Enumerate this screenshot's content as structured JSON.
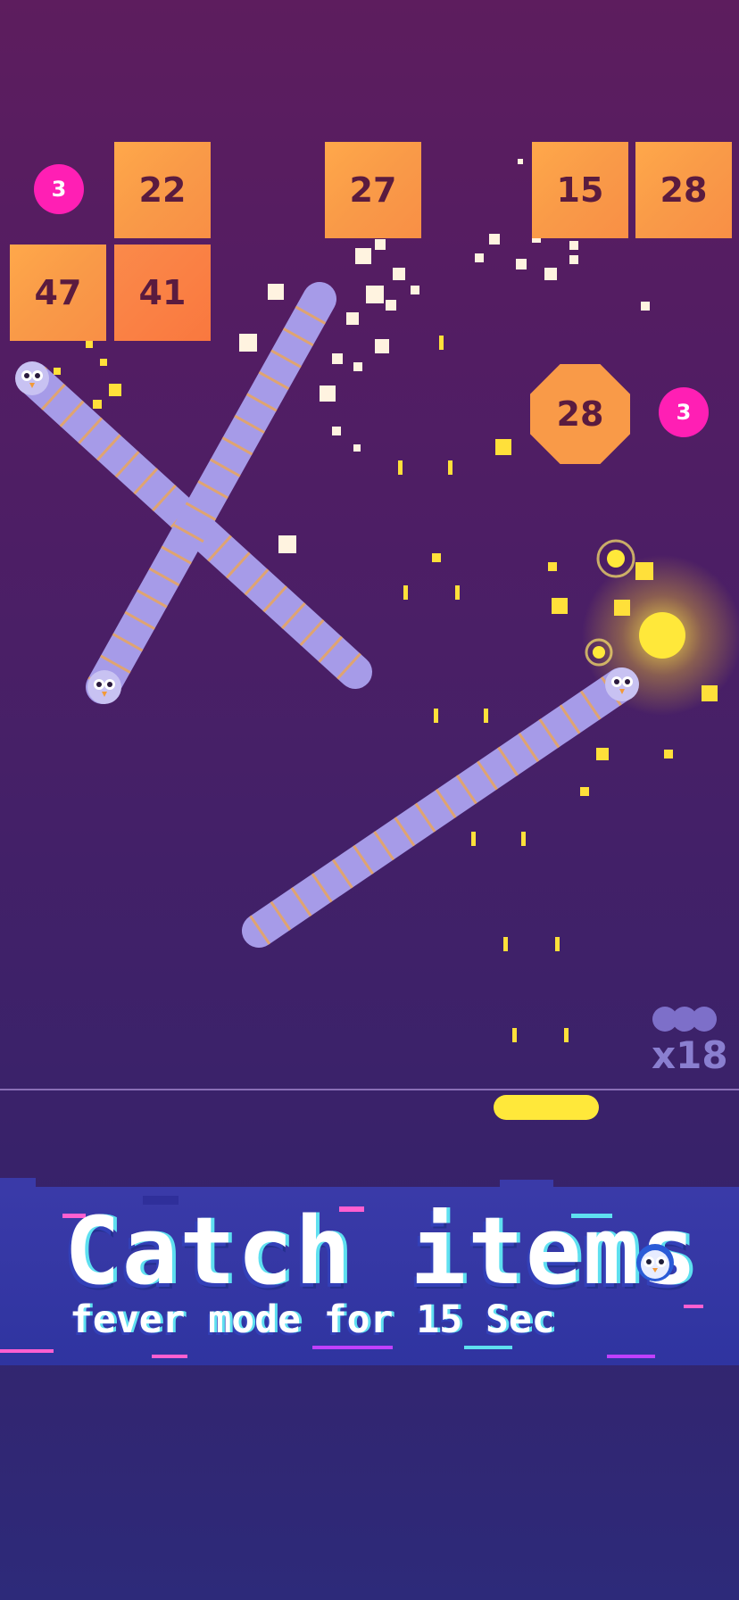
{
  "blocks": [
    {
      "value": "22"
    },
    {
      "value": "27"
    },
    {
      "value": "15"
    },
    {
      "value": "28"
    },
    {
      "value": "47"
    },
    {
      "value": "41"
    }
  ],
  "balls": [
    {
      "value": "3"
    },
    {
      "value": "3"
    }
  ],
  "octagon": {
    "value": "28"
  },
  "lives": {
    "count": "x18"
  },
  "banner": {
    "title": "Catch items",
    "subtitle": "fever mode for 15 Sec"
  },
  "colors": {
    "block": "#f99a48",
    "ball": "#ff1fb4",
    "snake": "#a69be8",
    "paddle": "#ffe83a"
  }
}
